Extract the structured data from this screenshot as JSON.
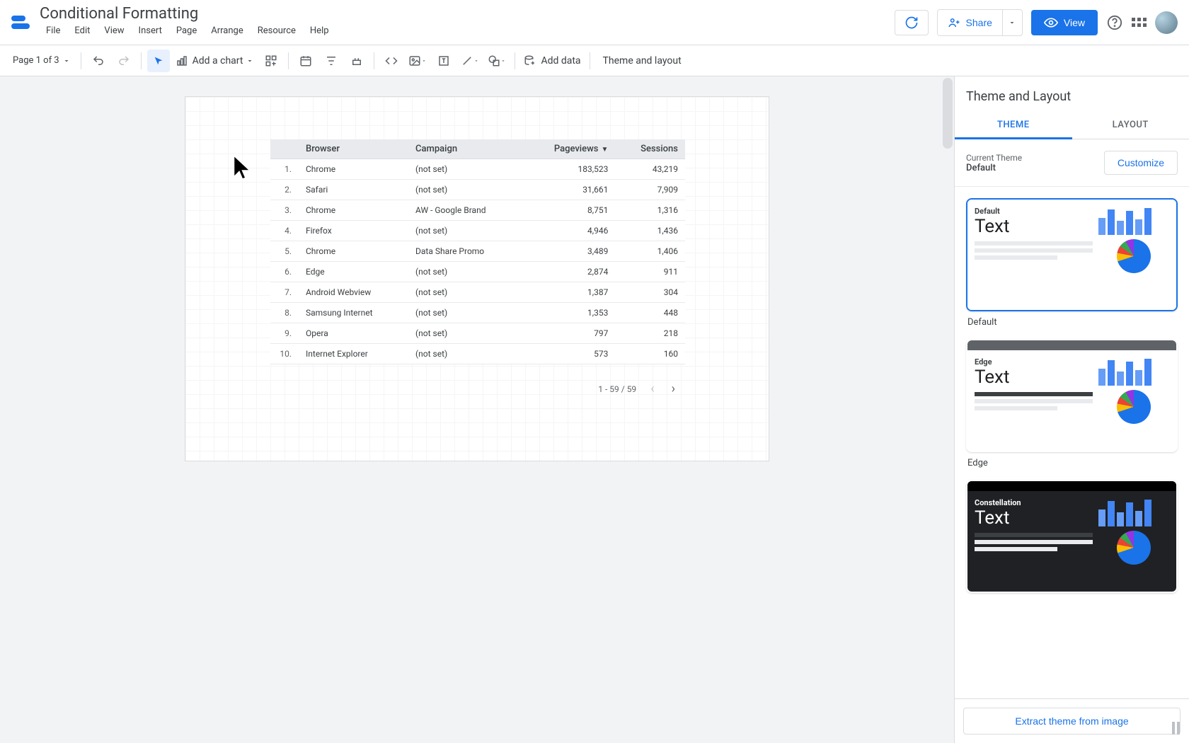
{
  "header": {
    "doc_title": "Conditional Formatting",
    "share_label": "Share",
    "view_label": "View"
  },
  "menu": [
    "File",
    "Edit",
    "View",
    "Insert",
    "Page",
    "Arrange",
    "Resource",
    "Help"
  ],
  "toolbar": {
    "page_indicator": "Page 1 of 3",
    "add_chart": "Add a chart",
    "add_data": "Add data",
    "theme_layout": "Theme and layout"
  },
  "table": {
    "headers": [
      "",
      "Browser",
      "Campaign",
      "Pageviews",
      "Sessions"
    ],
    "sort_column": "Pageviews",
    "rows": [
      {
        "idx": "1.",
        "browser": "Chrome",
        "campaign": "(not set)",
        "pageviews": "183,523",
        "sessions": "43,219"
      },
      {
        "idx": "2.",
        "browser": "Safari",
        "campaign": "(not set)",
        "pageviews": "31,661",
        "sessions": "7,909"
      },
      {
        "idx": "3.",
        "browser": "Chrome",
        "campaign": "AW - Google Brand",
        "pageviews": "8,751",
        "sessions": "1,316"
      },
      {
        "idx": "4.",
        "browser": "Firefox",
        "campaign": "(not set)",
        "pageviews": "4,946",
        "sessions": "1,436"
      },
      {
        "idx": "5.",
        "browser": "Chrome",
        "campaign": "Data Share Promo",
        "pageviews": "3,489",
        "sessions": "1,406"
      },
      {
        "idx": "6.",
        "browser": "Edge",
        "campaign": "(not set)",
        "pageviews": "2,874",
        "sessions": "911"
      },
      {
        "idx": "7.",
        "browser": "Android Webview",
        "campaign": "(not set)",
        "pageviews": "1,387",
        "sessions": "304"
      },
      {
        "idx": "8.",
        "browser": "Samsung Internet",
        "campaign": "(not set)",
        "pageviews": "1,353",
        "sessions": "448"
      },
      {
        "idx": "9.",
        "browser": "Opera",
        "campaign": "(not set)",
        "pageviews": "797",
        "sessions": "218"
      },
      {
        "idx": "10.",
        "browser": "Internet Explorer",
        "campaign": "(not set)",
        "pageviews": "573",
        "sessions": "160"
      }
    ],
    "pagination": "1 - 59 / 59"
  },
  "panel": {
    "title": "Theme and Layout",
    "tabs": [
      "THEME",
      "LAYOUT"
    ],
    "active_tab": "THEME",
    "current_theme_label": "Current Theme",
    "current_theme_name": "Default",
    "customize_label": "Customize",
    "themes": [
      {
        "name": "Default",
        "label": "Default",
        "text": "Text",
        "selected": true
      },
      {
        "name": "Edge",
        "label": "Edge",
        "text": "Text",
        "selected": false
      },
      {
        "name": "Constellation",
        "label": "Constellation",
        "text": "Text",
        "selected": false
      }
    ],
    "extract_label": "Extract theme from image"
  }
}
